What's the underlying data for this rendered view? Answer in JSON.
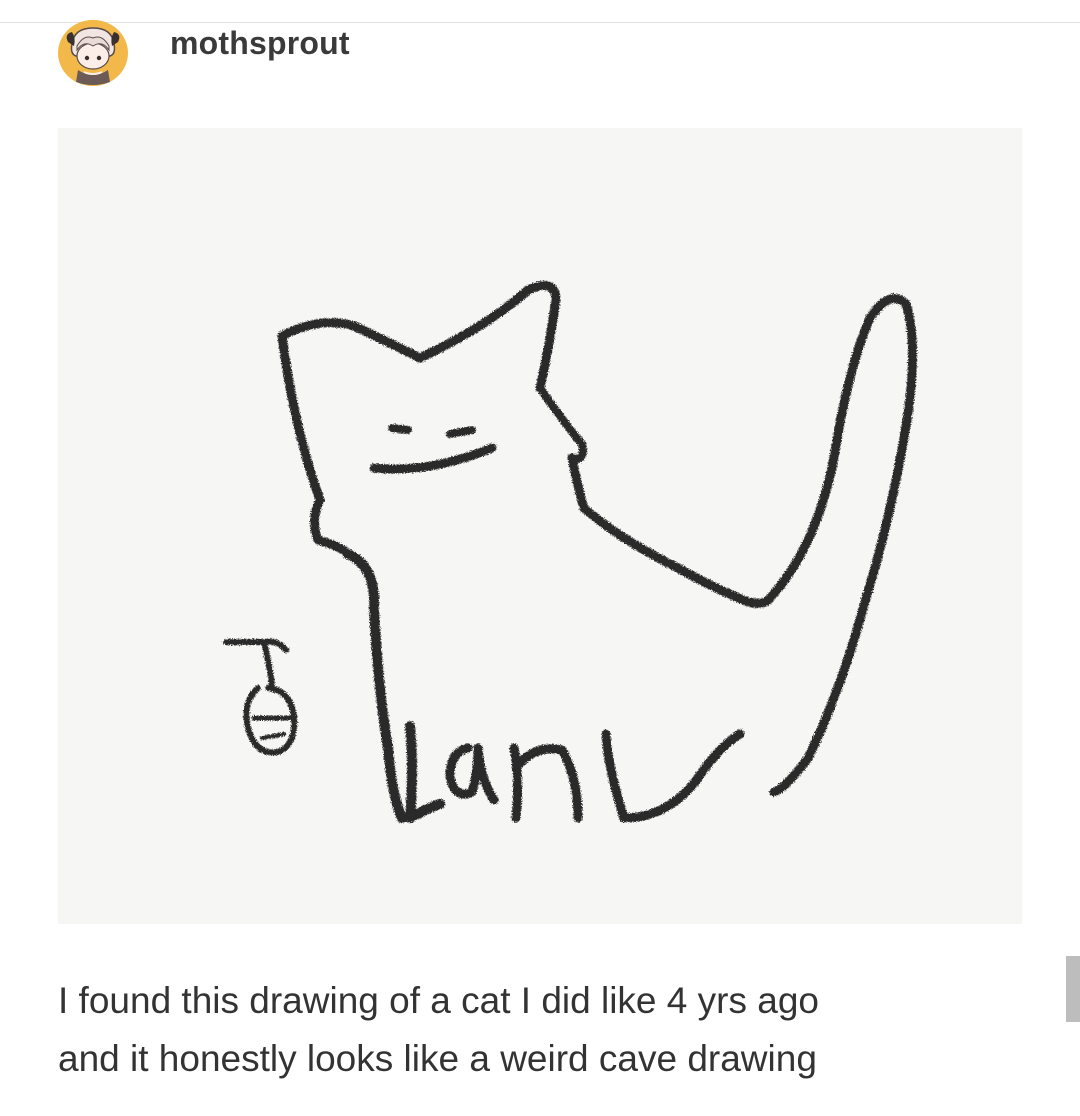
{
  "post": {
    "username": "mothsprout",
    "avatar_icon": "chibi-character-avatar-icon",
    "image": {
      "description_icon": "cat-sketch-drawing"
    },
    "caption_lines": [
      "I found this drawing of a cat I did like 4 yrs ago",
      "and it honestly looks like a weird cave drawing"
    ]
  },
  "colors": {
    "username": "#3a3a3a",
    "caption": "#333333",
    "ink": "#2b2b2b",
    "paper": "#f6f6f4",
    "avatar_bg": "#f2b94a"
  }
}
